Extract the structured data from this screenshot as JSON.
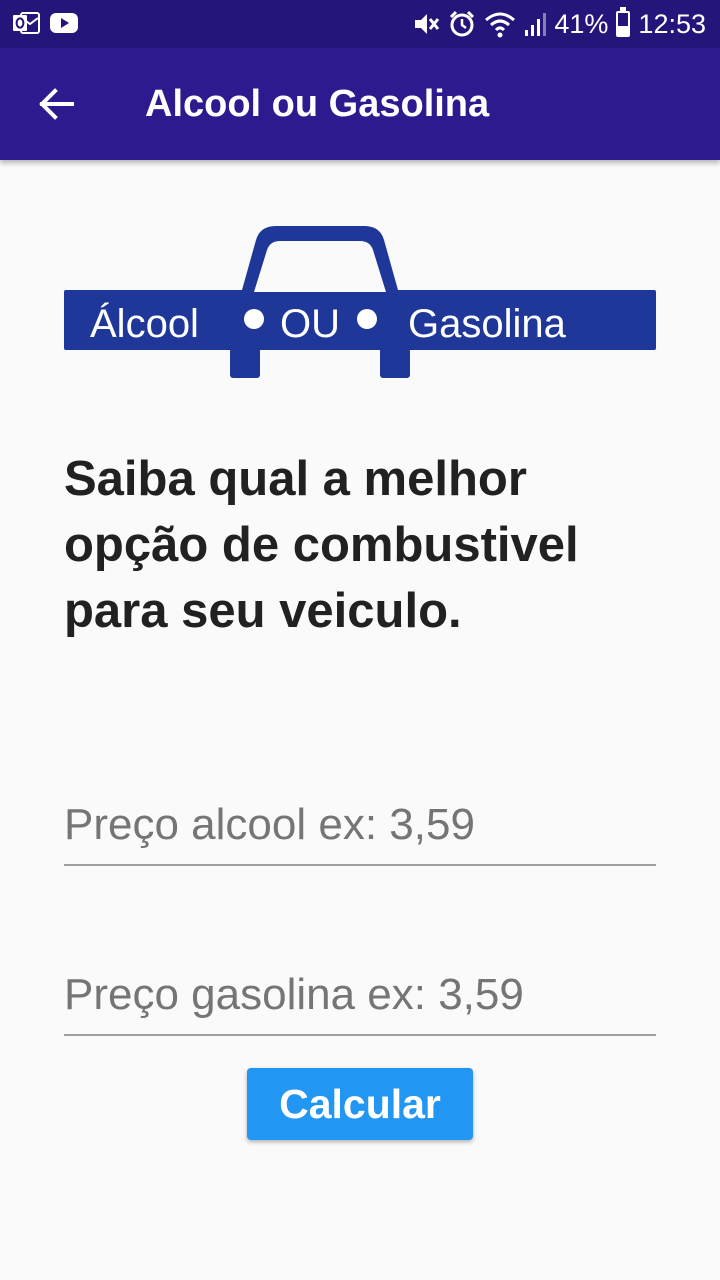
{
  "status_bar": {
    "battery_percent": "41%",
    "battery_level": 0.41,
    "time": "12:53",
    "icons": [
      "outlook-icon",
      "youtube-icon",
      "mute-icon",
      "alarm-icon",
      "wifi-icon",
      "signal-icon",
      "battery-icon"
    ]
  },
  "app_bar": {
    "title": "Alcool ou Gasolina",
    "back_icon": "arrow-back-icon",
    "color": "#2d1a8f"
  },
  "logo": {
    "left_word": "Álcool",
    "middle_word": "OU",
    "right_word": "Gasolina",
    "color": "#1e3799"
  },
  "headline": "Saiba qual a melhor opção de combustivel para seu veiculo.",
  "form": {
    "alcool_placeholder": "Preço alcool ex: 3,59",
    "alcool_value": "",
    "gasolina_placeholder": "Preço gasolina ex: 3,59",
    "gasolina_value": ""
  },
  "calculate_label": "Calcular",
  "accent_color": "#2196f3"
}
